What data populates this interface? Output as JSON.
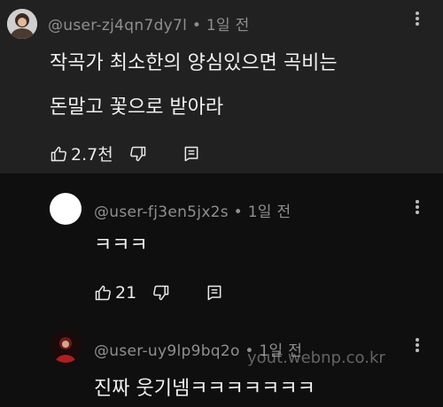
{
  "comment": {
    "meta": "@user-zj4qn7dy7l • 1일 전",
    "lines": [
      "작곡가 최소한의 양심있으면 곡비는",
      "돈말고 꽃으로 받아라"
    ],
    "likes": "2.7천"
  },
  "reply1": {
    "meta": "@user-fj3en5jx2s • 1일 전",
    "text": "ㅋㅋㅋ",
    "likes": "21"
  },
  "reply2": {
    "meta": "@user-uy9lp9bq2o • 1일 전",
    "text": "진짜 웃기넴ㅋㅋㅋㅋㅋㅋㅋ"
  },
  "watermark": "yout.webnp.co.kr",
  "colors": {
    "top_bg": "#212121",
    "reply_bg": "#0f0f0f",
    "meta": "#8f8f8f"
  },
  "icons": [
    "thumb-up-icon",
    "thumb-down-icon",
    "reply-icon",
    "more-vert-icon"
  ]
}
